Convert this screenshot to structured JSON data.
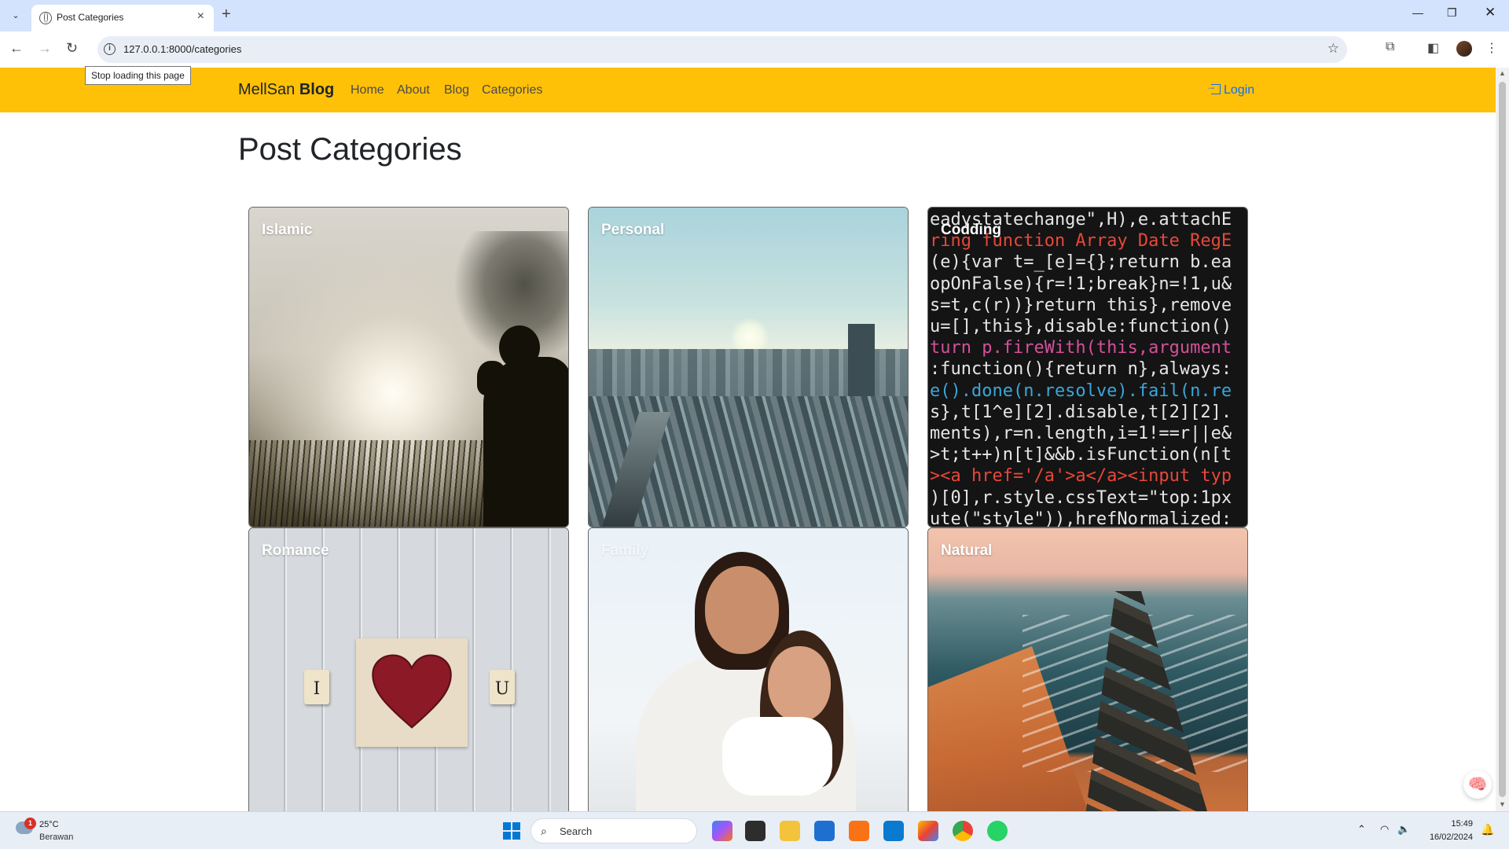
{
  "browser": {
    "tab_title": "Post Categories",
    "url": "127.0.0.1:8000/categories",
    "tooltip": "Stop loading this page"
  },
  "navbar": {
    "brand_prefix": "MellSan",
    "brand_bold": "Blog",
    "links": [
      "Home",
      "About",
      "Blog",
      "Categories"
    ],
    "login_label": "Login",
    "bg_color": "#ffc107"
  },
  "page": {
    "title": "Post Categories",
    "categories": [
      {
        "name": "Islamic"
      },
      {
        "name": "Personal"
      },
      {
        "name": "Codding"
      },
      {
        "name": "Romance"
      },
      {
        "name": "Family"
      },
      {
        "name": "Natural"
      }
    ]
  },
  "code_image": {
    "lines": [
      "eadystatechange\",H),e.attachE",
      "ring function Array Date RegE",
      "(e){var t=_[e]={};return b.ea",
      "opOnFalse){r=!1;break}n=!1,u&",
      "s=t,c(r))}return this},remove",
      "u=[],this},disable:function()",
      "turn p.fireWith(this,argument",
      ":function(){return n},always:",
      "e().done(n.resolve).fail(n.re",
      "s},t[1^e][2].disable,t[2][2].",
      "ments),r=n.length,i=1!==r||e&",
      ">t;t++)n[t]&&b.isFunction(n[t",
      "><a href='/a'>a</a><input typ",
      ")[0],r.style.cssText=\"top:1px",
      "ute(\"style\")),hrefNormalized:"
    ]
  },
  "romance_image": {
    "tile_left": "I",
    "tile_right": "U"
  },
  "taskbar": {
    "weather_temp": "25°C",
    "weather_desc": "Berawan",
    "weather_badge": "1",
    "search_placeholder": "Search",
    "time": "15:49",
    "date": "16/02/2024"
  }
}
